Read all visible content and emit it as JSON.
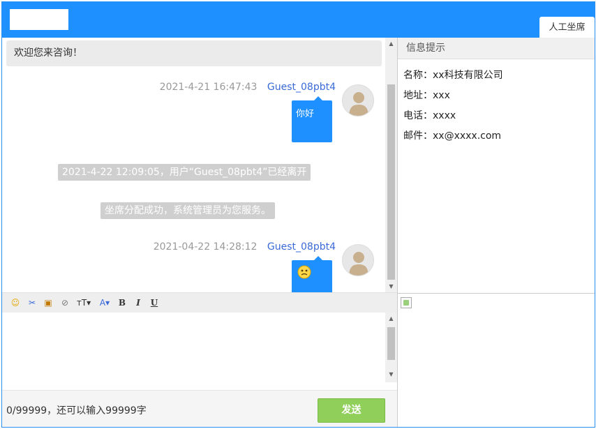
{
  "header": {
    "agent_tab": "人工坐席"
  },
  "chat": {
    "welcome": "欢迎您来咨询！",
    "messages": [
      {
        "time": "2021-4-21 16:47:43",
        "user": "Guest_08pbt4",
        "text": "你好"
      },
      {
        "time": "2021-04-22 14:28:12",
        "user": "Guest_08pbt4",
        "emoji": "smiley-sweat-icon"
      }
    ],
    "system_notes": [
      "2021-4-22 12:09:05，用户“Guest_08pbt4”已经离开",
      "坐席分配成功，系统管理员为您服务。"
    ]
  },
  "toolbar": {
    "items": [
      {
        "name": "emoji-icon",
        "glyph": "☺"
      },
      {
        "name": "scissors-icon",
        "glyph": "✂"
      },
      {
        "name": "image-icon",
        "glyph": "▣"
      },
      {
        "name": "attachment-icon",
        "glyph": "⊘"
      },
      {
        "name": "font-size-icon",
        "glyph": "тT▾"
      },
      {
        "name": "font-color-icon",
        "glyph": "A▾"
      },
      {
        "name": "bold-icon",
        "glyph": "B"
      },
      {
        "name": "italic-icon",
        "glyph": "I"
      },
      {
        "name": "underline-icon",
        "glyph": "U"
      }
    ]
  },
  "input": {
    "value": ""
  },
  "footer": {
    "counter": "0/99999，还可以输入99999字",
    "send_label": "发送"
  },
  "info": {
    "title": "信息提示",
    "lines": [
      "名称：xx科技有限公司",
      "地址：xxx",
      "电话：xxxx",
      "邮件：xx@xxxx.com"
    ]
  },
  "colors": {
    "header_blue": "#1e90ff",
    "send_green": "#8fcf5a",
    "user_link": "#3a6ad8"
  }
}
